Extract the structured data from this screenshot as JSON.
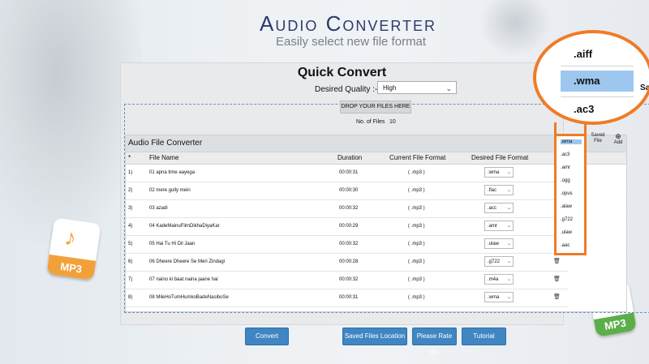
{
  "app": {
    "title": "Audio Converter",
    "subtitle": "Easily select new file format"
  },
  "quick_convert": {
    "title": "Quick Convert",
    "quality_label": "Desired Quality :-",
    "quality_value": "High",
    "drop_label": "DROP YOUR FILES HERE",
    "files_label": "No. of Files",
    "files_count": "10"
  },
  "table": {
    "caption": "Audio File Converter",
    "headers": {
      "index": "*",
      "name": "File Name",
      "duration": "Duration",
      "current": "Current File Format",
      "desired": "Desired File Format"
    },
    "rows": [
      {
        "index": "1)",
        "name": "01 apna time aayega",
        "duration": "00:00:31",
        "current": "( .mp3 )",
        "desired": ".wma"
      },
      {
        "index": "2)",
        "name": "02 mere gully mein",
        "duration": "00:00:30",
        "current": "( .mp3 )",
        "desired": ".flac"
      },
      {
        "index": "3)",
        "name": "03 azadi",
        "duration": "00:00:32",
        "current": "( .mp3 )",
        "desired": ".acc"
      },
      {
        "index": "4)",
        "name": "04 KadeMainuFilmDikhaDiyaKar",
        "duration": "00:00:29",
        "current": "( .mp3 )",
        "desired": ".amr"
      },
      {
        "index": "5)",
        "name": "05 Hai Tu Hi Dil Jaan",
        "duration": "00:00:32",
        "current": "( .mp3 )",
        "desired": ".ulaw"
      },
      {
        "index": "6)",
        "name": "06 Dheere Dheere Se Meri Zindagi",
        "duration": "00:00:28",
        "current": "( .mp3 )",
        "desired": ".g722"
      },
      {
        "index": "7)",
        "name": "07 naino ki baat naina jaane hai",
        "duration": "00:00:32",
        "current": "( .mp3 )",
        "desired": ".m4a"
      },
      {
        "index": "8)",
        "name": "08 MileHoTumHumkoBadeNasiboSe",
        "duration": "00:00:31",
        "current": "( .mp3 )",
        "desired": ".wma"
      }
    ]
  },
  "side_controls": {
    "saved": "Saved File",
    "add": "Add"
  },
  "dropdown_list": [
    ".wma",
    ".ac3",
    ".amr",
    ".ogg",
    ".opus",
    ".alaw",
    ".g722",
    ".ulaw",
    ".aac"
  ],
  "zoom": {
    "items": [
      ".aiff",
      ".wma",
      ".ac3"
    ],
    "selected": ".wma",
    "fragment": "Sa"
  },
  "buttons": {
    "convert": "Convert",
    "saved_location": "Saved Files Location",
    "rate": "Please Rate Us.",
    "tutorial": "Tutorial"
  },
  "badges": {
    "left": "MP3",
    "right": "MP3"
  },
  "icons": {
    "trash": "trash-icon",
    "chevron": "chevron-down-icon",
    "add": "add-icon",
    "note": "music-note-icon"
  },
  "colors": {
    "accent": "#f07b25",
    "button": "#3f86c3",
    "selection": "#9dc7ee",
    "title": "#2c3a68",
    "badge_left": "#f2a13a",
    "badge_right": "#5cae4a"
  }
}
